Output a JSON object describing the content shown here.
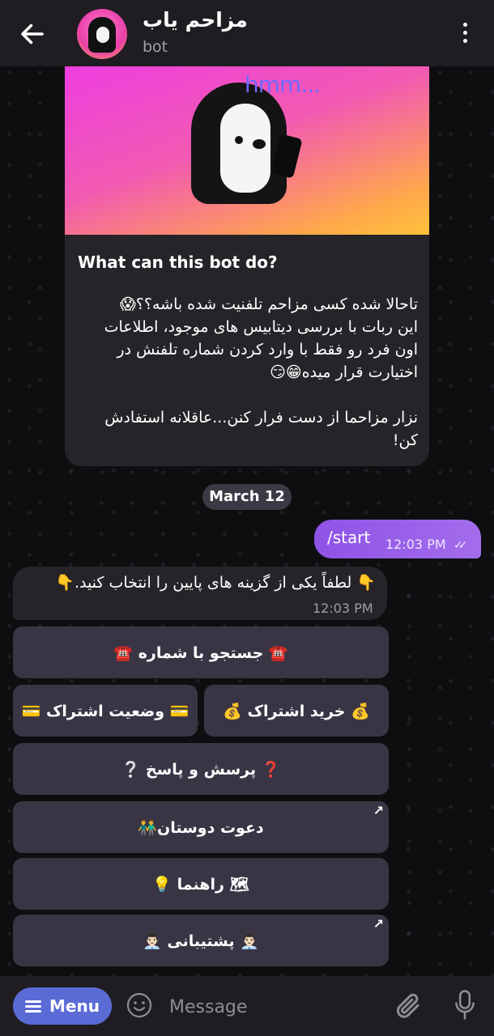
{
  "header": {
    "title": "مزاحم یاب",
    "subtitle": "bot"
  },
  "intro": {
    "sticker_text": "hmm...",
    "heading": "What can this bot do?",
    "body": "تاحالا شده کسی مزاحم تلفنیت شده باشه؟؟😱\nاین ربات با بررسی دیتابیس های موجود، اطلاعات اون فرد رو فقط با وارد کردن شماره تلفنش در اختیارت قرار میده😁😏\n\nنزار مزاحما از دست فرار کنن...عاقلانه استفادش کن!"
  },
  "date_separator": "March 12",
  "messages": [
    {
      "direction": "out",
      "text": "/start",
      "time": "12:03 PM",
      "status": "read"
    },
    {
      "direction": "in",
      "text": "👇 لطفاً یکی از گزینه های پایین را انتخاب کنید.👇",
      "time": "12:03 PM"
    }
  ],
  "keyboard": {
    "search": "☎️ جستجو با شماره ☎️",
    "buy": "💰 خرید اشتراک 💰",
    "status": "💳 وضعیت اشتراک 💳",
    "faq": "❓ پرسش و پاسخ ❔",
    "invite": "دعوت دوستان👬",
    "guide": "🗺 راهنما 💡",
    "support": "👨🏻‍💼 پشتیبانی 👨🏻‍💼",
    "external_mark": "↗"
  },
  "input_bar": {
    "menu_label": "Menu",
    "placeholder": "Message"
  },
  "icons": {
    "back": "arrow-left",
    "more": "vertical-dots",
    "emoji": "smiley",
    "attach": "paperclip",
    "mic": "microphone"
  },
  "colors": {
    "accent": "#9a5fea",
    "menu_button": "#5a6bd6",
    "keyboard_button": "#3a3545"
  }
}
